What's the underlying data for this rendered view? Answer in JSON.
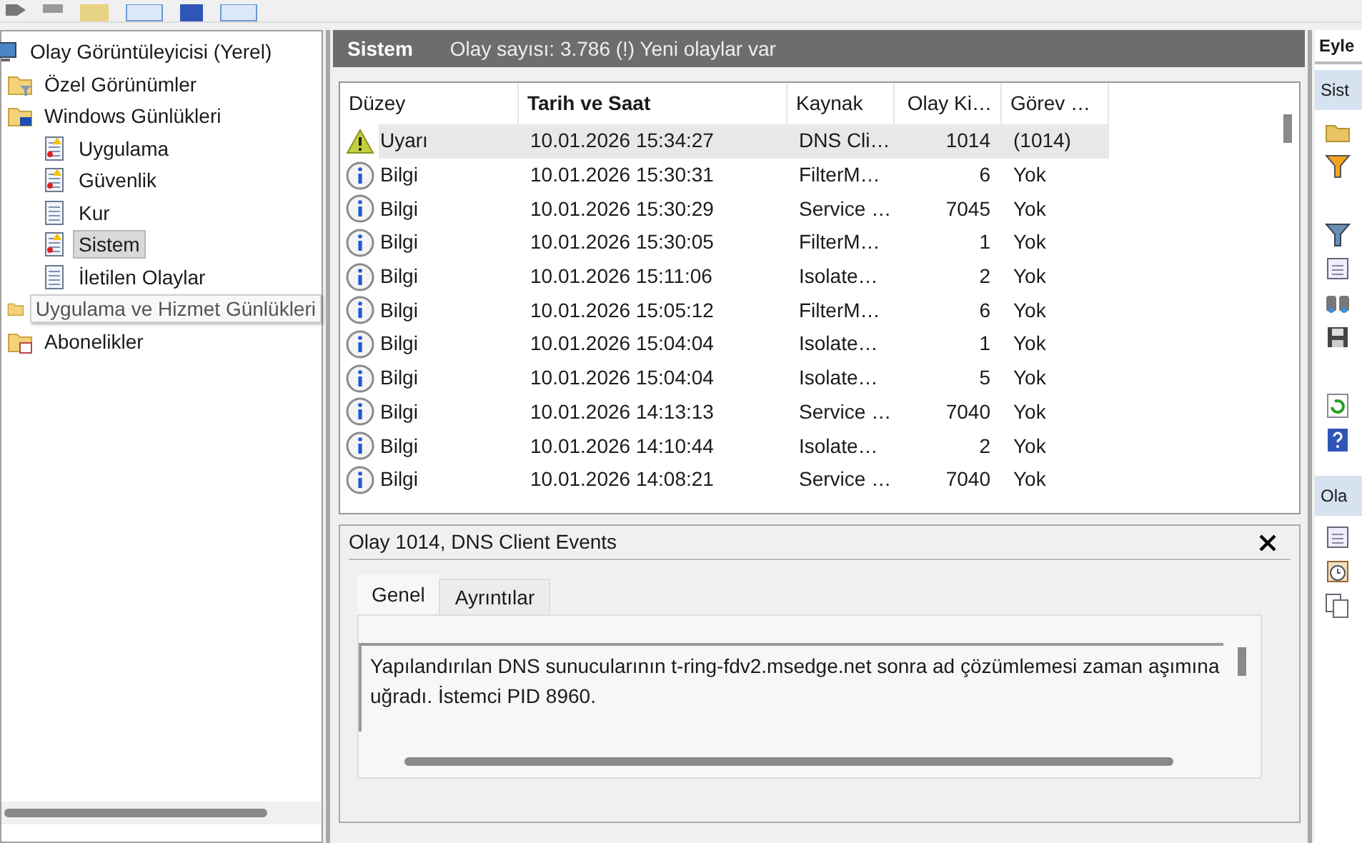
{
  "tree": [
    {
      "label": "Olay Görüntüleyicisi (Yerel)",
      "kind": "root",
      "selected": false,
      "tooltip": false,
      "children": [
        {
          "label": "Özel Görünümler",
          "kind": "filter-folder",
          "selected": false,
          "tooltip": false
        },
        {
          "label": "Windows Günlükleri",
          "kind": "windows-folder",
          "selected": false,
          "tooltip": false,
          "children": [
            {
              "label": "Uygulama",
              "kind": "alert-log",
              "selected": false,
              "tooltip": false
            },
            {
              "label": "Güvenlik",
              "kind": "alert-log",
              "selected": false,
              "tooltip": false
            },
            {
              "label": "Kur",
              "kind": "log",
              "selected": false,
              "tooltip": false
            },
            {
              "label": "Sistem",
              "kind": "alert-log",
              "selected": true,
              "tooltip": false
            },
            {
              "label": "İletilen Olaylar",
              "kind": "log",
              "selected": false,
              "tooltip": false
            }
          ]
        },
        {
          "label": "Uygulama ve Hizmet Günlükleri",
          "kind": "folder",
          "selected": false,
          "tooltip": true
        },
        {
          "label": "Abonelikler",
          "kind": "subscription",
          "selected": false,
          "tooltip": false
        }
      ]
    }
  ],
  "header": {
    "title": "Sistem",
    "summary": "Olay sayısı: 3.786 (!) Yeni olaylar var"
  },
  "table": {
    "columns": [
      {
        "label": "Düzey",
        "sorted": false
      },
      {
        "label": "Tarih ve Saat",
        "sorted": true
      },
      {
        "label": "Kaynak",
        "sorted": false
      },
      {
        "label": "Olay Ki…",
        "sorted": false
      },
      {
        "label": "Görev …",
        "sorted": false
      }
    ],
    "rows": [
      {
        "kind": "warning",
        "selected": true,
        "cells": [
          "Uyarı",
          "10.01.2026 15:34:27",
          "DNS Cli…",
          "1014",
          "(1014)"
        ]
      },
      {
        "kind": "info",
        "selected": false,
        "cells": [
          "Bilgi",
          "10.01.2026 15:30:31",
          "FilterM…",
          "6",
          "Yok"
        ]
      },
      {
        "kind": "info",
        "selected": false,
        "cells": [
          "Bilgi",
          "10.01.2026 15:30:29",
          "Service …",
          "7045",
          "Yok"
        ]
      },
      {
        "kind": "info",
        "selected": false,
        "cells": [
          "Bilgi",
          "10.01.2026 15:30:05",
          "FilterM…",
          "1",
          "Yok"
        ]
      },
      {
        "kind": "info",
        "selected": false,
        "cells": [
          "Bilgi",
          "10.01.2026 15:11:06",
          "Isolate…",
          "2",
          "Yok"
        ]
      },
      {
        "kind": "info",
        "selected": false,
        "cells": [
          "Bilgi",
          "10.01.2026 15:05:12",
          "FilterM…",
          "6",
          "Yok"
        ]
      },
      {
        "kind": "info",
        "selected": false,
        "cells": [
          "Bilgi",
          "10.01.2026 15:04:04",
          "Isolate…",
          "1",
          "Yok"
        ]
      },
      {
        "kind": "info",
        "selected": false,
        "cells": [
          "Bilgi",
          "10.01.2026 15:04:04",
          "Isolate…",
          "5",
          "Yok"
        ]
      },
      {
        "kind": "info",
        "selected": false,
        "cells": [
          "Bilgi",
          "10.01.2026 14:13:13",
          "Service …",
          "7040",
          "Yok"
        ]
      },
      {
        "kind": "info",
        "selected": false,
        "cells": [
          "Bilgi",
          "10.01.2026 14:10:44",
          "Isolate…",
          "2",
          "Yok"
        ]
      },
      {
        "kind": "info",
        "selected": false,
        "cells": [
          "Bilgi",
          "10.01.2026 14:08:21",
          "Service …",
          "7040",
          "Yok"
        ]
      }
    ]
  },
  "detail": {
    "title": "Olay 1014, DNS Client Events",
    "tabs": [
      {
        "label": "Genel",
        "selected": true
      },
      {
        "label": "Ayrıntılar",
        "selected": false
      }
    ],
    "description": "Yapılandırılan DNS sunucularının t-ring-fdv2.msedge.net sonra ad çözümlemesi zaman aşımına uğradı. İstemci PID 8960."
  },
  "actions": {
    "heading": "Eyle",
    "sections": [
      {
        "label": "Sist"
      },
      {
        "label": "Ola"
      }
    ]
  }
}
